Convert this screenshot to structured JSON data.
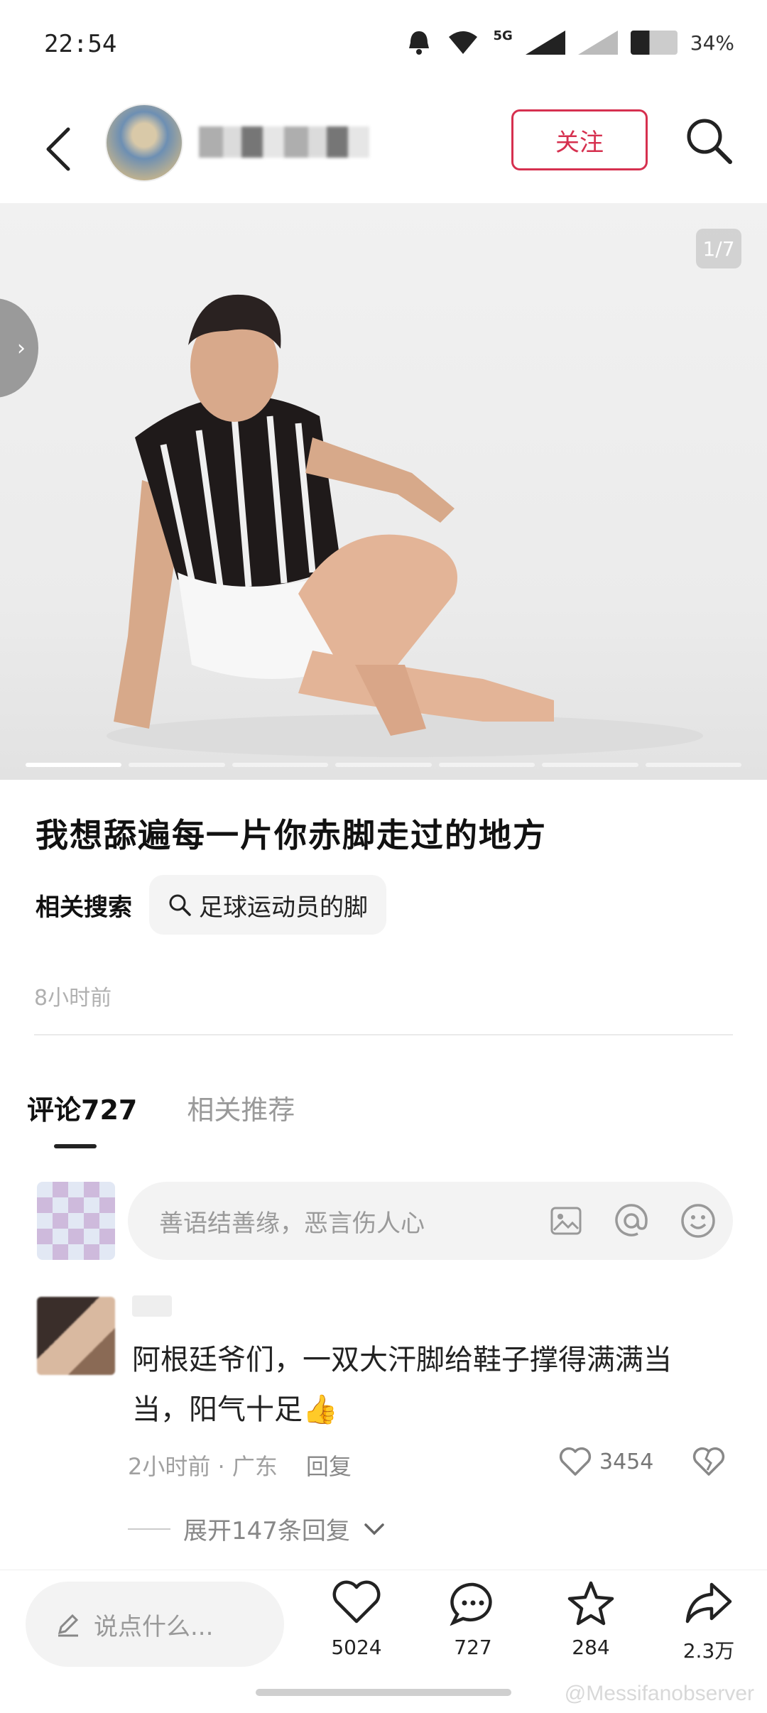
{
  "status_bar": {
    "time": "22:54",
    "network": "5G",
    "battery": "34%"
  },
  "header": {
    "follow_label": "关注"
  },
  "photo": {
    "counter": "1/7",
    "page_index": 1,
    "page_total": 7,
    "arrow": "›"
  },
  "post": {
    "title": "我想舔遍每一片你赤脚走过的地方",
    "related_label": "相关搜索",
    "related_query": "足球运动员的脚",
    "time": "8小时前"
  },
  "tabs": [
    {
      "label": "评论727",
      "active": true
    },
    {
      "label": "相关推荐",
      "active": false
    }
  ],
  "comment_box": {
    "placeholder": "善语结善缘，恶言伤人心"
  },
  "comment": {
    "text": "阿根廷爷们，一双大汗脚给鞋子撑得满满当当，阳气十足👍",
    "time": "2小时前",
    "location": "· 广东",
    "reply_label": "回复",
    "likes": "3454",
    "expand_label": "展开147条回复"
  },
  "bottom_bar": {
    "input_placeholder": "说点什么...",
    "like_count": "5024",
    "comment_count": "727",
    "favorite_count": "284",
    "share_count": "2.3万"
  },
  "watermark": "@Messifanobserver",
  "colors": {
    "accent": "#d6304f"
  }
}
